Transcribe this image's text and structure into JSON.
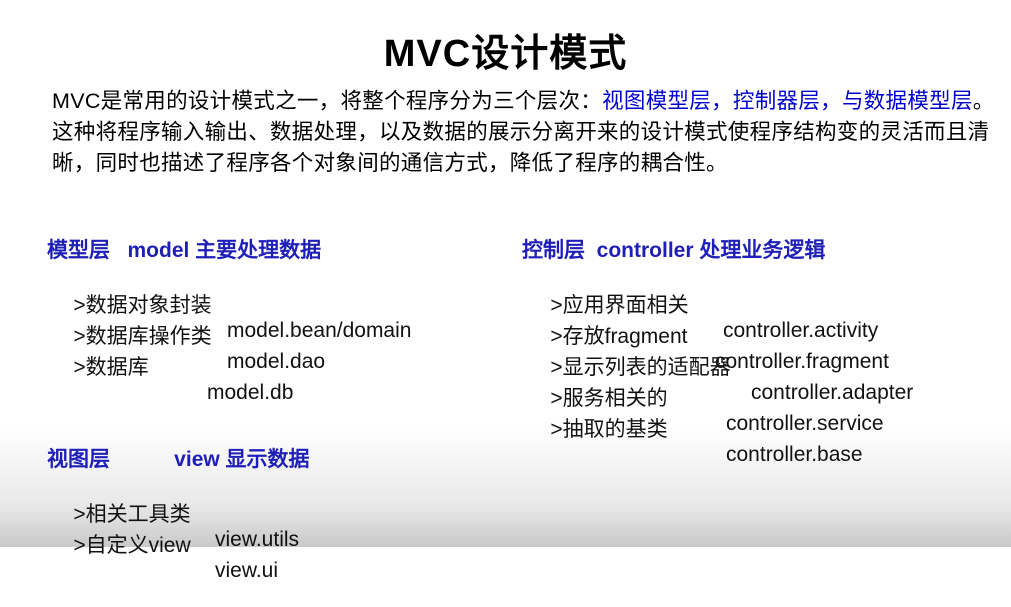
{
  "title": "MVC设计模式",
  "intro": {
    "part1": "MVC是常用的设计模式之一，将整个程序分为三个层次：",
    "hl1": "视图模型层",
    "sep1": "，",
    "hl2": "控制器层",
    "sep2": "，",
    "hl3": "与数据模型层",
    "part2": "。这种将程序输入输出、数据处理，以及数据的展示分离开来的设计模式使程序结构变的灵活而且清晰，同时也描述了程序各个对象间的通信方式，降低了程序的耦合性。"
  },
  "model": {
    "heading": "模型层   model 主要处理数据",
    "items": [
      {
        "label": ">数据对象封装",
        "value": "model.bean/domain"
      },
      {
        "label": ">数据库操作类",
        "value": "model.dao"
      },
      {
        "label": ">数据库",
        "value": "model.db"
      }
    ]
  },
  "controller": {
    "heading": "控制层  controller 处理业务逻辑",
    "items": [
      {
        "label": ">应用界面相关",
        "value": "controller.activity"
      },
      {
        "label": ">存放fragment",
        "value": "controller.fragment"
      },
      {
        "label": ">显示列表的适配器",
        "value": "controller.adapter"
      },
      {
        "label": ">服务相关的",
        "value": "controller.service"
      },
      {
        "label": ">抽取的基类",
        "value": "controller.base"
      }
    ]
  },
  "view": {
    "heading": "视图层           view 显示数据",
    "items": [
      {
        "label": ">相关工具类",
        "value": "view.utils"
      },
      {
        "label": ">自定义view",
        "value": "view.ui"
      }
    ]
  }
}
